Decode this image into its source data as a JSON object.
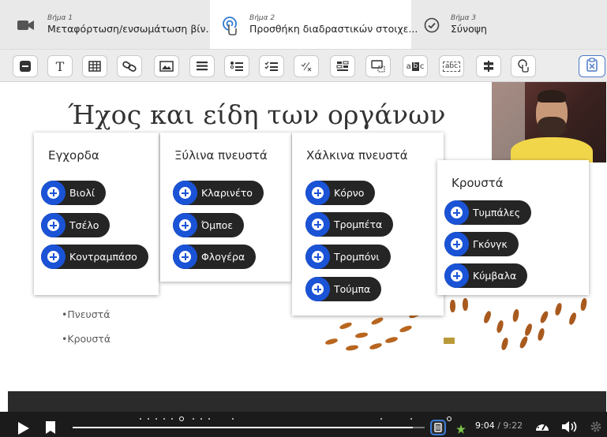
{
  "steps": [
    {
      "num": "Βήμα 1",
      "label": "Μεταφόρτωση/ενσωμάτωση βίν...",
      "icon": "video-camera-icon"
    },
    {
      "num": "Βήμα 2",
      "label": "Προσθήκη διαδραστικών στοιχε...",
      "icon": "touch-icon"
    },
    {
      "num": "Βήμα 3",
      "label": "Σύνοψη",
      "icon": "check-circle-icon"
    }
  ],
  "toolbar": {
    "text_glyph": "T",
    "abc_glyph": "abc",
    "ab_glyph": "a",
    "ab_glyph2": "c"
  },
  "slide": {
    "title": "Ήχος και είδη των οργάνων",
    "bullets": [
      "•Πνευστά",
      "•Κρουστά"
    ]
  },
  "cards": [
    {
      "title": "Εγχορδα",
      "items": [
        "Βιολί",
        "Τσέλο",
        "Κοντραμπάσο"
      ]
    },
    {
      "title": "Ξύλινα πνευστά",
      "items": [
        "Κλαρινέτο",
        "Όμποε",
        "Φλογέρα"
      ]
    },
    {
      "title": "Χάλκινα πνευστά",
      "items": [
        "Κόρνο",
        "Τρομπέτα",
        "Τρομπόνι",
        "Τούμπα"
      ]
    },
    {
      "title": "Κρουστά",
      "items": [
        "Τυμπάλες",
        "Γκόνγκ",
        "Κύμβαλα"
      ]
    }
  ],
  "player": {
    "current_time": "9:04",
    "separator": " / ",
    "total_time": "9:22",
    "progress_fraction": 0.967
  },
  "colors": {
    "accent_blue": "#1a53d6",
    "pill_dark": "#252525",
    "header_bg": "#e9e9e9"
  }
}
